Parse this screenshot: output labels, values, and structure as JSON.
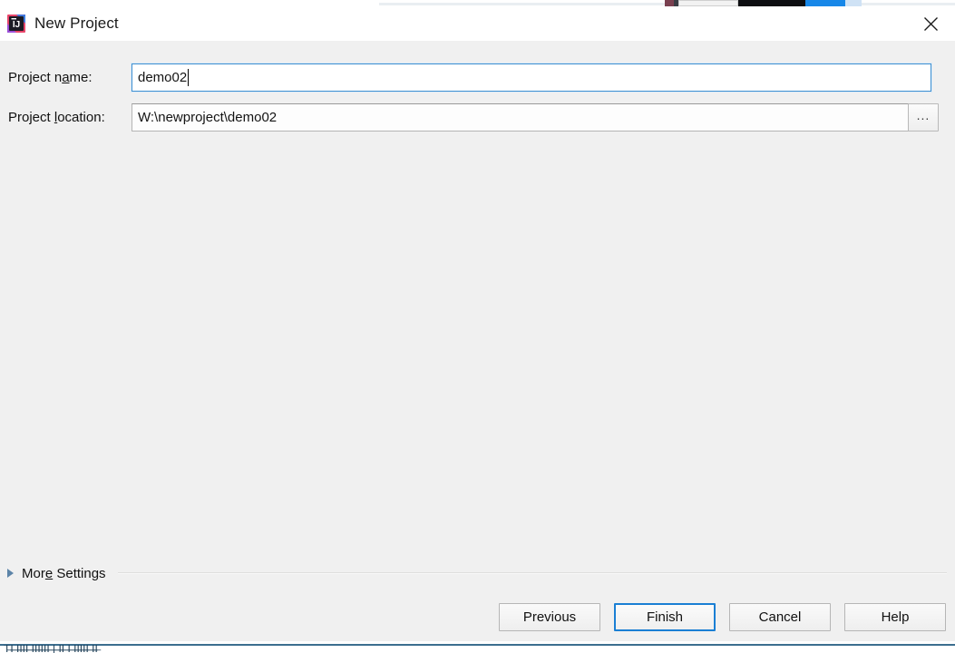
{
  "background": {
    "bottom_text": "T̶I̶ ̶I̶I̶I̶I̶ ̶I̶I̶I̶I̶I̶I̶ ̶|̶ ̶I̶I̶ ̶I̶ ̶I̶I̶I̶I̶I̶ ̶I̶I̶"
  },
  "titlebar": {
    "title": "New Project",
    "icon": "intellij-idea-logo",
    "close_icon": "close-icon"
  },
  "form": {
    "project_name": {
      "label_prefix": "Project n",
      "label_mnemonic": "a",
      "label_suffix": "me:",
      "value": "demo02",
      "placeholder": "",
      "focused": true
    },
    "project_location": {
      "label_prefix": "Project ",
      "label_mnemonic": "l",
      "label_suffix": "ocation:",
      "value": "W:\\newproject\\demo02",
      "placeholder": "",
      "focused": false
    },
    "browse_button_label": "..."
  },
  "more_settings": {
    "label_prefix": "Mor",
    "label_mnemonic": "e",
    "label_suffix": " Settings",
    "expanded": false,
    "disclosure_icon": "triangle-right-icon"
  },
  "footer": {
    "buttons": [
      {
        "label": "Previous",
        "name": "previous-button",
        "default": false
      },
      {
        "label": "Finish",
        "name": "finish-button",
        "default": true
      },
      {
        "label": "Cancel",
        "name": "cancel-button",
        "default": false
      },
      {
        "label": "Help",
        "name": "help-button",
        "default": false
      }
    ]
  },
  "colors": {
    "dialog_background": "#f0f0f0",
    "titlebar_background": "#ffffff",
    "focus_blue": "#3f8fd0",
    "default_button_blue": "#1a7fd4",
    "disclosure_blue": "#5c84a8",
    "text": "#111111",
    "background_accent_blue": "#1787e8",
    "background_rule": "#3c6e8f"
  }
}
